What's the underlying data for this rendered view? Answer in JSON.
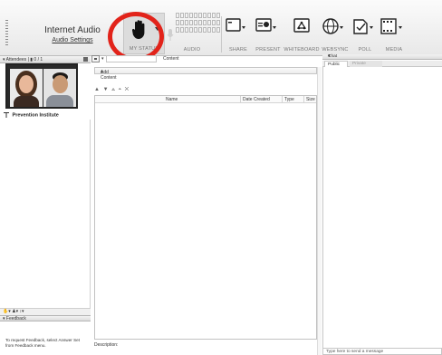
{
  "toolbar": {
    "audio_title": "Internet Audio",
    "audio_settings_link": "Audio Settings",
    "buttons": {
      "my_status": "MY STATUS",
      "audio": "AUDIO",
      "share": "SHARE",
      "present": "PRESENT",
      "whiteboard": "WHITEBOARD",
      "websync": "WEBSYNC",
      "poll": "POLL",
      "media": "MEDIA"
    },
    "highlight_color": "#e2231a"
  },
  "attendees": {
    "header_label": "Attendees",
    "count": "0 / 1",
    "presenter_name": "Prevention Institute"
  },
  "content": {
    "tab_label": "Content",
    "add_content_label": "Add Content",
    "columns": [
      "Name",
      "Date Created",
      "Type",
      "Size"
    ],
    "rows": [],
    "description_label": "Description:"
  },
  "feedback": {
    "header_label": "Feedback",
    "hint_text": "To request Feedback, select Answer Set from Feedback menu."
  },
  "chat": {
    "header_label": "Chat",
    "tabs": [
      "Public",
      "Private"
    ],
    "input_placeholder": "Type here to send a message"
  }
}
